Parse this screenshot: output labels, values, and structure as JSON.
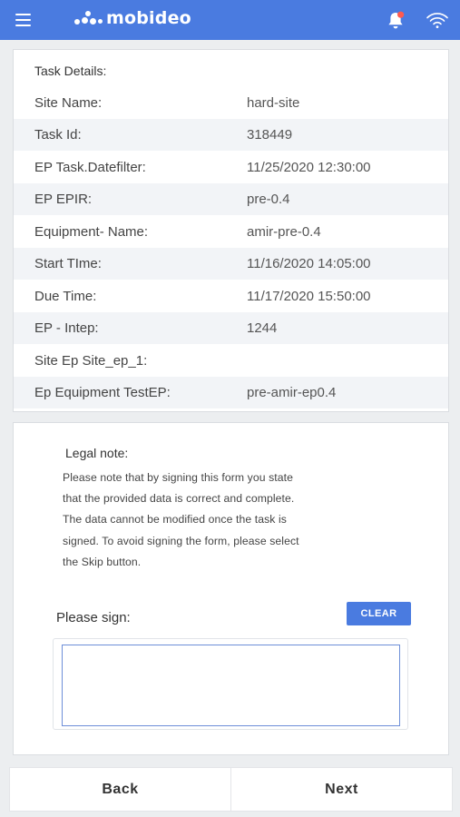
{
  "header": {
    "brand": "mobideo",
    "icons": [
      "menu-icon",
      "bell-icon",
      "wifi-icon"
    ],
    "notification_dot_color": "#ff5a4f",
    "bar_color": "#4a7be0"
  },
  "task_details": {
    "title": "Task Details:",
    "rows": [
      {
        "label": "Site Name:",
        "value": "hard-site"
      },
      {
        "label": "Task Id:",
        "value": "318449"
      },
      {
        "label": "EP Task.Datefilter:",
        "value": "11/25/2020 12:30:00"
      },
      {
        "label": "EP EPIR:",
        "value": "pre-0.4"
      },
      {
        "label": "Equipment- Name:",
        "value": "amir-pre-0.4"
      },
      {
        "label": "Start TIme:",
        "value": "11/16/2020 14:05:00"
      },
      {
        "label": "Due Time:",
        "value": "11/17/2020 15:50:00"
      },
      {
        "label": "EP - Intep:",
        "value": "1244"
      },
      {
        "label": "Site Ep Site_ep_1:",
        "value": ""
      },
      {
        "label": "Ep Equipment TestEP:",
        "value": "pre-amir-ep0.4"
      }
    ]
  },
  "legal": {
    "title": "Legal note:",
    "lines": [
      "Please note that by signing this form you state",
      "that the provided data is correct and complete.",
      "The data cannot be modified once the task is",
      "signed. To avoid signing the form, please select",
      "the Skip button."
    ],
    "sign_label": "Please sign:",
    "clear_label": "CLEAR"
  },
  "footer": {
    "back_label": "Back",
    "next_label": "Next"
  }
}
